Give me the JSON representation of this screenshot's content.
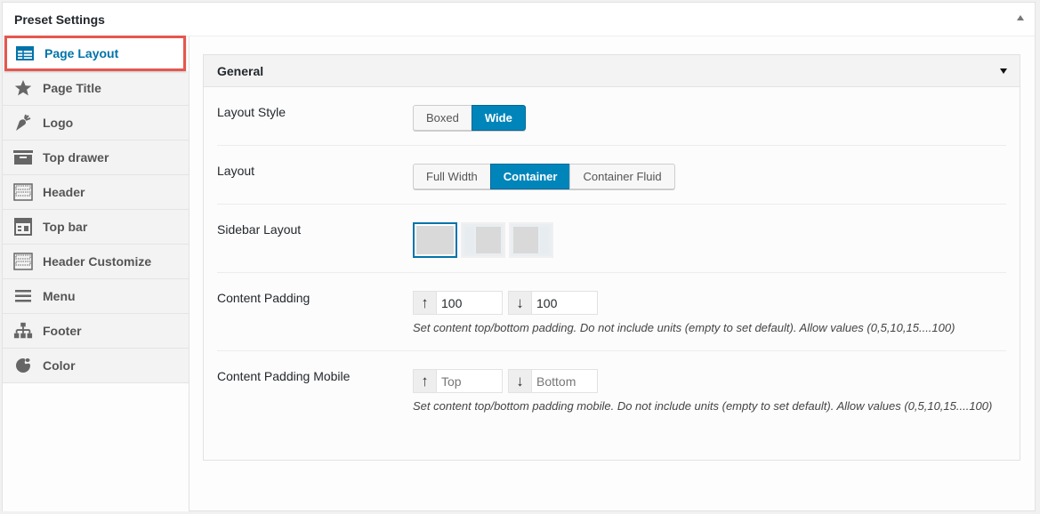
{
  "panel": {
    "title": "Preset Settings",
    "toggle_icon": "triangle-up-icon"
  },
  "sidebar": {
    "items": [
      {
        "label": "Page Layout",
        "icon": "table-layout-icon",
        "active": true
      },
      {
        "label": "Page Title",
        "icon": "star-icon"
      },
      {
        "label": "Logo",
        "icon": "carrot-icon"
      },
      {
        "label": "Top drawer",
        "icon": "archive-box-icon"
      },
      {
        "label": "Header",
        "icon": "header-rows-icon"
      },
      {
        "label": "Top bar",
        "icon": "top-bar-grid-icon"
      },
      {
        "label": "Header Customize",
        "icon": "header-rows-icon"
      },
      {
        "label": "Menu",
        "icon": "hamburger-menu-icon"
      },
      {
        "label": "Footer",
        "icon": "sitemap-icon"
      },
      {
        "label": "Color",
        "icon": "palette-icon"
      }
    ]
  },
  "section": {
    "title": "General",
    "toggle_icon": "triangle-down-icon",
    "rows": {
      "layout_style": {
        "label": "Layout Style",
        "options": [
          "Boxed",
          "Wide"
        ],
        "selected": "Wide"
      },
      "layout": {
        "label": "Layout",
        "options": [
          "Full Width",
          "Container",
          "Container Fluid"
        ],
        "selected": "Container"
      },
      "sidebar_layout": {
        "label": "Sidebar Layout",
        "options": [
          "no-sidebar",
          "left-sidebar",
          "right-sidebar"
        ],
        "selected": "no-sidebar"
      },
      "content_padding": {
        "label": "Content Padding",
        "top_value": "100",
        "bottom_value": "100",
        "description": "Set content top/bottom padding. Do not include units (empty to set default). Allow values (0,5,10,15....100)"
      },
      "content_padding_mobile": {
        "label": "Content Padding Mobile",
        "top_placeholder": "Top",
        "bottom_placeholder": "Bottom",
        "description": "Set content top/bottom padding mobile. Do not include units (empty to set default). Allow values (0,5,10,15....100)"
      }
    }
  },
  "colors": {
    "accent": "#0085ba",
    "highlight_border": "#e5574e",
    "active_text": "#0073aa"
  }
}
